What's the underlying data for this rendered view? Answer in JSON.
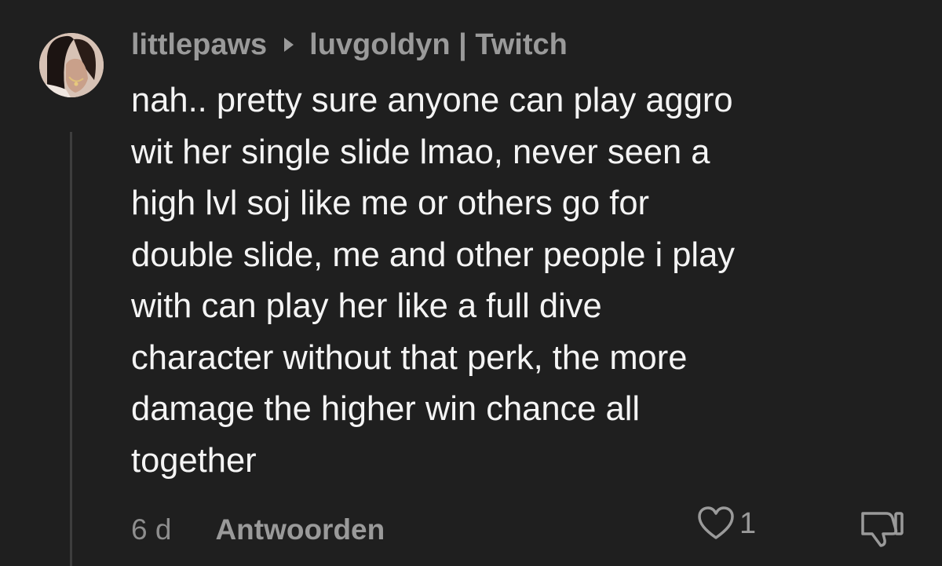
{
  "comment": {
    "author": "littlepaws",
    "reply_to": "luvgoldyn | Twitch",
    "text": "nah.. pretty sure anyone can play aggro\nwit her single slide lmao, never seen a\nhigh lvl soj like me or others go for\ndouble slide, me and other people i play\nwith can play her like a full dive\ncharacter without that perk, the more\ndamage the higher win chance all\ntogether",
    "time": "6 d",
    "reply_label": "Antwoorden",
    "like_count": "1",
    "icons": {
      "reply_to": "reply-arrow-icon",
      "like": "heart-icon",
      "dislike": "thumbs-down-icon"
    }
  },
  "colors": {
    "background": "#1f1f1f",
    "text": "#f4f4f4",
    "muted": "#9a9a9a"
  }
}
